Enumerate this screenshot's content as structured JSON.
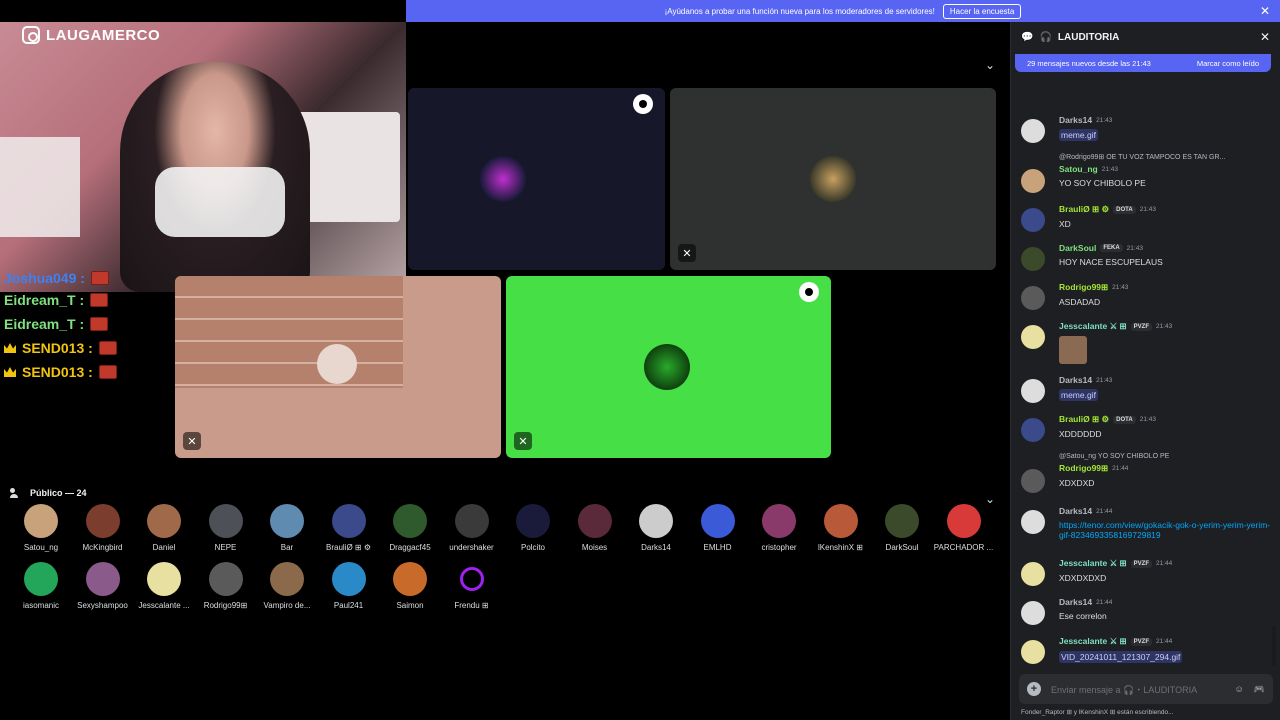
{
  "banner": {
    "text": "¡Ayúdanos a probar una función nueva para los moderadores de servidores!",
    "button": "Hacer la encuesta",
    "close": "✕"
  },
  "webcam": {
    "channel": "LAUGAMERCO"
  },
  "stream_chat": [
    {
      "name": "Joshua049 :",
      "color": "#3b82f6",
      "crown": false
    },
    {
      "name": "Eidream_T :",
      "color": "#7ee07e",
      "crown": false
    },
    {
      "name": "Eidream_T :",
      "color": "#7ee07e",
      "crown": false
    },
    {
      "name": "SEND013 :",
      "color": "#f1c40f",
      "crown": true
    },
    {
      "name": "SEND013 :",
      "color": "#f1c40f",
      "crown": true
    }
  ],
  "public": {
    "label": "Público — 24"
  },
  "audience": [
    {
      "name": "Satou_ng",
      "color": "#c8a27a"
    },
    {
      "name": "McKingbird",
      "color": "#7a3d2e"
    },
    {
      "name": "Daniel",
      "color": "#a06a4a"
    },
    {
      "name": "NEPE",
      "color": "#4e5058"
    },
    {
      "name": "Bar",
      "color": "#5f8bb0"
    },
    {
      "name": "BrauliØ ⊞ ⚙",
      "color": "#3a4a8a"
    },
    {
      "name": "Draggacf45",
      "color": "#2e5a2e"
    },
    {
      "name": "undershaker",
      "color": "#3a3a3a"
    },
    {
      "name": "Polcito",
      "color": "#1a1a3a"
    },
    {
      "name": "Moises",
      "color": "#5a2a3a"
    },
    {
      "name": "Darks14",
      "color": "#cccccc"
    },
    {
      "name": "EMLHD",
      "color": "#3a5ad8"
    },
    {
      "name": "cristopher",
      "color": "#8a3a6a"
    },
    {
      "name": "lKenshinX ⊞",
      "color": "#b85a3a"
    },
    {
      "name": "DarkSoul",
      "color": "#3a4a2a"
    },
    {
      "name": "PARCHADOR ...",
      "color": "#d83a3a"
    },
    {
      "name": "iasomanic",
      "color": "#23a55a"
    },
    {
      "name": "Sexyshampoo",
      "color": "#8a5a8a"
    },
    {
      "name": "Jesscalante ...",
      "color": "#e8e0a0"
    },
    {
      "name": "Rodrigo99⊞",
      "color": "#5a5a5a"
    },
    {
      "name": "Vampiro de...",
      "color": "#8a6a4a"
    },
    {
      "name": "Paul241",
      "color": "#2a8ac8"
    },
    {
      "name": "Saimon",
      "color": "#c86a2a"
    },
    {
      "name": "Frendu ⊞",
      "color": "#000000"
    }
  ],
  "chat": {
    "channel": "LAUDITORIA",
    "new_messages": "29 mensajes nuevos desde las 21:43",
    "mark_read": "Marcar como leído",
    "placeholder": "Enviar mensaje a 🎧・LAUDITORIA",
    "typing": "Fonder_Raptor ⊞ y lKenshinX ⊞ están escribiendo...",
    "messages": [
      {
        "name": "Darks14",
        "time": "21:43",
        "text": "meme.gif",
        "kind": "att",
        "color": "#b5bac1",
        "av": "#dddddd"
      },
      {
        "reply": "@Rodrigo99⊞ OE TU VOZ TAMPOCO ES TAN GR...",
        "name": "Satou_ng",
        "time": "21:43",
        "text": "YO SOY CHIBOLO PE",
        "color": "#7ee07e",
        "av": "#c8a27a"
      },
      {
        "name": "BrauliØ ⊞ ⚙",
        "badge": "DOTA",
        "time": "21:43",
        "text": "XD",
        "color": "#a3e635",
        "av": "#3a4a8a"
      },
      {
        "name": "DarkSoul",
        "badge": "FEKA",
        "time": "21:43",
        "text": "HOY NACE ESCUPELAUS",
        "color": "#7ee07e",
        "av": "#3a4a2a"
      },
      {
        "name": "Rodrigo99⊞",
        "time": "21:43",
        "text": "ASDADAD",
        "color": "#a3e635",
        "av": "#5a5a5a"
      },
      {
        "name": "Jesscalante ⚔ ⊞",
        "badge": "PVZF",
        "time": "21:43",
        "text": "",
        "kind": "img",
        "color": "#7ee0c0",
        "av": "#e8e0a0"
      },
      {
        "name": "Darks14",
        "time": "21:43",
        "text": "meme.gif",
        "kind": "att",
        "color": "#b5bac1",
        "av": "#dddddd"
      },
      {
        "name": "BrauliØ ⊞ ⚙",
        "badge": "DOTA",
        "time": "21:43",
        "text": "XDDDDDD",
        "color": "#a3e635",
        "av": "#3a4a8a"
      },
      {
        "reply": "@Satou_ng YO SOY CHIBOLO PE",
        "name": "Rodrigo99⊞",
        "time": "21:44",
        "text": "XDXDXD",
        "color": "#a3e635",
        "av": "#5a5a5a"
      },
      {
        "name": "Darks14",
        "time": "21:44",
        "text": "https://tenor.com/view/gokacik-gok-o-yerim-yerim-yerim-gif-8234693358169729819",
        "kind": "link",
        "color": "#b5bac1",
        "av": "#dddddd"
      },
      {
        "name": "Jesscalante ⚔ ⊞",
        "badge": "PVZF",
        "time": "21:44",
        "text": "XDXDXDXD",
        "color": "#7ee0c0",
        "av": "#e8e0a0"
      },
      {
        "name": "Darks14",
        "time": "21:44",
        "text": "Ese correlon",
        "color": "#b5bac1",
        "av": "#dddddd"
      },
      {
        "name": "Jesscalante ⚔ ⊞",
        "badge": "PVZF",
        "time": "21:44",
        "text": "VID_20241011_121307_294.gif",
        "kind": "att",
        "color": "#7ee0c0",
        "av": "#e8e0a0"
      }
    ]
  }
}
